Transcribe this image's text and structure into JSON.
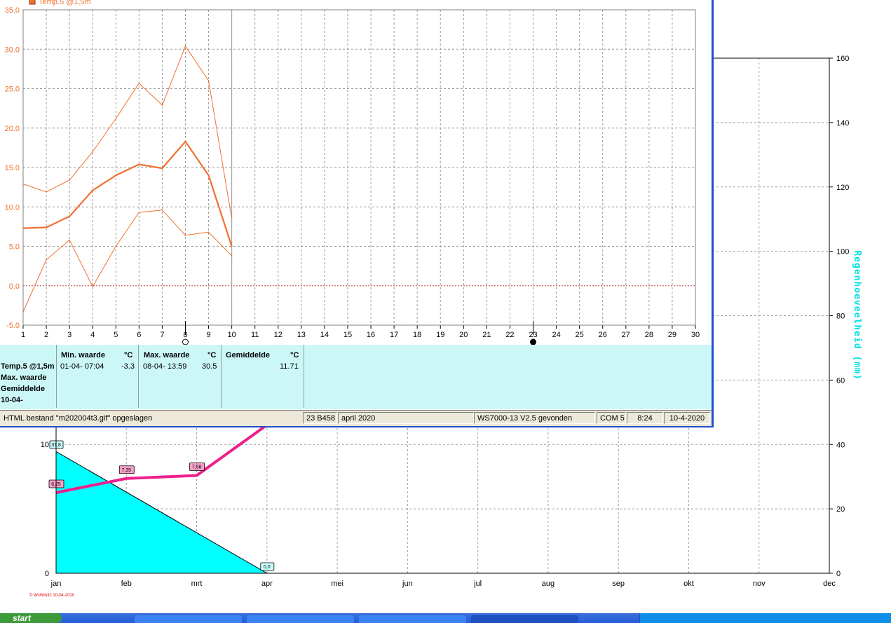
{
  "temp_window": {
    "series_legend": "Temp.5 @1,5m",
    "stats": {
      "row_labels": [
        "Temp.5 @1,5m",
        "Max. waarde",
        "Gemiddelde",
        "10-04-"
      ],
      "min_header": "Min. waarde",
      "min_unit": "°C",
      "min_date": "01-04-  07:04",
      "min_value": "-3.3",
      "max_header": "Max. waarde",
      "max_unit": "°C",
      "max_date": "08-04-  13:59",
      "max_value": "30.5",
      "avg_header": "Gemiddelde",
      "avg_unit": "°C",
      "avg_value": "11.71"
    },
    "status_bar": {
      "message": "HTML bestand  \"m202004t3.gif\"  opgeslagen",
      "code": "23 B458",
      "period": "april 2020",
      "device": "WS7000-13 V2.5 gevonden",
      "port": "COM 5",
      "time": "8:24",
      "date": "10-4-2020"
    }
  },
  "watermark": "© WsWin32  10-04-2020",
  "taskbar": {
    "start_label": "start"
  },
  "colors": {
    "temp_line": "#f07030",
    "zero_line": "#c04040",
    "rain_fill": "#00ffff",
    "rain_axis_title": "#00e0e0",
    "monthly_temp_line": "#ee1f8c",
    "stats_bg": "#ccf7f7",
    "window_border": "#1f4fd0"
  },
  "chart_data": [
    {
      "type": "line",
      "title": "",
      "xlabel": "",
      "ylabel": "",
      "x": [
        1,
        2,
        3,
        4,
        5,
        6,
        7,
        8,
        9,
        10
      ],
      "xlim": [
        1,
        30
      ],
      "ylim": [
        -5,
        35
      ],
      "x_ticks": [
        "1",
        "2",
        "3",
        "4",
        "5",
        "6",
        "7",
        "8",
        "9",
        "10",
        "11",
        "12",
        "13",
        "14",
        "15",
        "16",
        "17",
        "18",
        "19",
        "20",
        "21",
        "22",
        "23",
        "24",
        "25",
        "26",
        "27",
        "28",
        "29",
        "30"
      ],
      "y_ticks": [
        "-5.0",
        "0.0",
        "5.0",
        "10.0",
        "15.0",
        "20.0",
        "25.0",
        "30.0",
        "35.0"
      ],
      "grid": true,
      "moon_phase_markers": [
        {
          "day": 8,
          "phase": "full-moon"
        },
        {
          "day": 23,
          "phase": "new-moon"
        }
      ],
      "series": [
        {
          "name": "Temp.5 @1,5m",
          "role": "daily average",
          "values": [
            7.3,
            7.4,
            8.8,
            12.1,
            14.0,
            15.4,
            14.9,
            18.3,
            14.0,
            5.0
          ]
        },
        {
          "role": "daily maximum",
          "values": [
            12.9,
            11.9,
            13.4,
            17.0,
            21.2,
            25.7,
            22.9,
            30.4,
            26.0,
            8.5
          ]
        },
        {
          "role": "daily minimum",
          "values": [
            -3.3,
            3.3,
            5.8,
            -0.1,
            5.0,
            9.3,
            9.6,
            6.4,
            6.8,
            3.8
          ]
        }
      ]
    },
    {
      "type": "area",
      "title": "",
      "categories": [
        "jan",
        "feb",
        "mrt",
        "apr",
        "mei",
        "jun",
        "jul",
        "aug",
        "sep",
        "okt",
        "nov",
        "dec"
      ],
      "right_axis_label": "Regenhoeveelheid  (mm)",
      "right_ylim": [
        0,
        160
      ],
      "right_y_ticks": [
        "0",
        "20",
        "40",
        "60",
        "80",
        "100",
        "120",
        "140",
        "160"
      ],
      "left_y_ticks": [
        "0",
        "10"
      ],
      "grid": true,
      "series": [
        {
          "role": "rainfall (area)",
          "x": [
            "jan",
            "apr"
          ],
          "values": [
            37.8,
            0.0
          ],
          "point_labels": [
            "37,8",
            "0,0"
          ]
        },
        {
          "role": "monthly temperature (line)",
          "x": [
            "jan",
            "feb",
            "mrt"
          ],
          "values": [
            6.25,
            7.35,
            7.58
          ],
          "point_labels": [
            "6,25",
            "7,35",
            "7,58"
          ]
        }
      ]
    }
  ]
}
